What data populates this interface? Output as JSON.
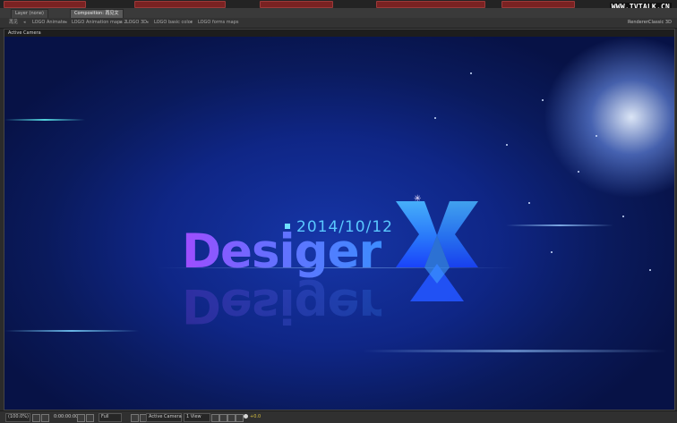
{
  "watermark": "WWW.TVTALK.CN",
  "tabs": [
    {
      "label": "Layer (none)"
    },
    {
      "label": "Composition: 再见文"
    }
  ],
  "flowchart": {
    "items": [
      "再见",
      "LOGO Animate",
      "LOGO Animation maps 2",
      "LOGO 3D",
      "LOGO basic color",
      "LOGO forms maps"
    ],
    "renderer_label": "Renderer:",
    "renderer_value": "Classic 3D"
  },
  "viewer": {
    "label": "Active Camera"
  },
  "artwork": {
    "date": "2014/10/12",
    "word": "Desiger"
  },
  "bottom_bar": {
    "zoom": "(100.0%)",
    "timecode": "0:00:00:00",
    "resolution": "Full",
    "view": "Active Camera",
    "views_count": "1 View",
    "exposure": "+0.0"
  },
  "colors": {
    "accent_blue": "#5ac8ff",
    "word_purple": "#a04cff",
    "exposure_yellow": "#d8c040"
  }
}
